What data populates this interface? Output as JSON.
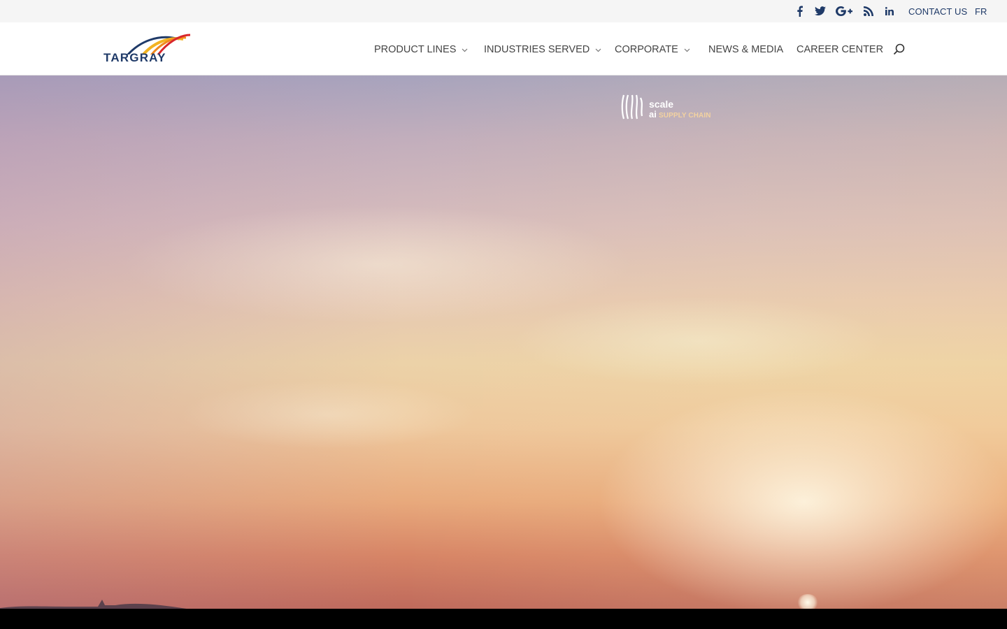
{
  "topbar": {
    "social": [
      "facebook-icon",
      "twitter-icon",
      "google-plus-icon",
      "rss-icon",
      "linkedin-icon"
    ],
    "contact_label": "CONTACT US",
    "lang_label": "FR"
  },
  "header": {
    "logo_text": "TARGRAY",
    "nav": [
      {
        "label": "PRODUCT LINES",
        "has_dropdown": true
      },
      {
        "label": "INDUSTRIES SERVED",
        "has_dropdown": true
      },
      {
        "label": "CORPORATE",
        "has_dropdown": true
      },
      {
        "label": "NEWS & MEDIA",
        "has_dropdown": false
      },
      {
        "label": "CAREER CENTER",
        "has_dropdown": false
      }
    ],
    "search_icon": "search-icon"
  },
  "hero": {
    "partner_logo": {
      "line1": "scale",
      "line2": "ai",
      "line3": "SUPPLY CHAIN"
    }
  },
  "colors": {
    "brand_navy": "#1f3a68",
    "topbar_bg": "#f5f5f5",
    "nav_text": "#444444"
  }
}
